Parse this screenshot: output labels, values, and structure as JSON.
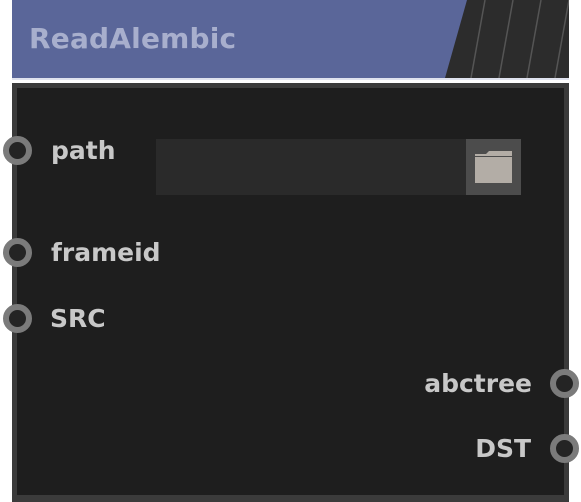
{
  "node": {
    "title": "ReadAlembic",
    "colors": {
      "header": "#5a6699",
      "title_text": "#a8afcd",
      "body": "#1e1e1e",
      "body_border": "#3b3b3b",
      "port_ring": "#7b7b7b",
      "label_text": "#c8c8c8"
    }
  },
  "inputs": {
    "path": {
      "label": "path",
      "value": "",
      "browse_icon": "folder-icon"
    },
    "frameid": {
      "label": "frameid"
    },
    "src": {
      "label": "SRC"
    }
  },
  "outputs": {
    "abctree": {
      "label": "abctree"
    },
    "dst": {
      "label": "DST"
    }
  }
}
